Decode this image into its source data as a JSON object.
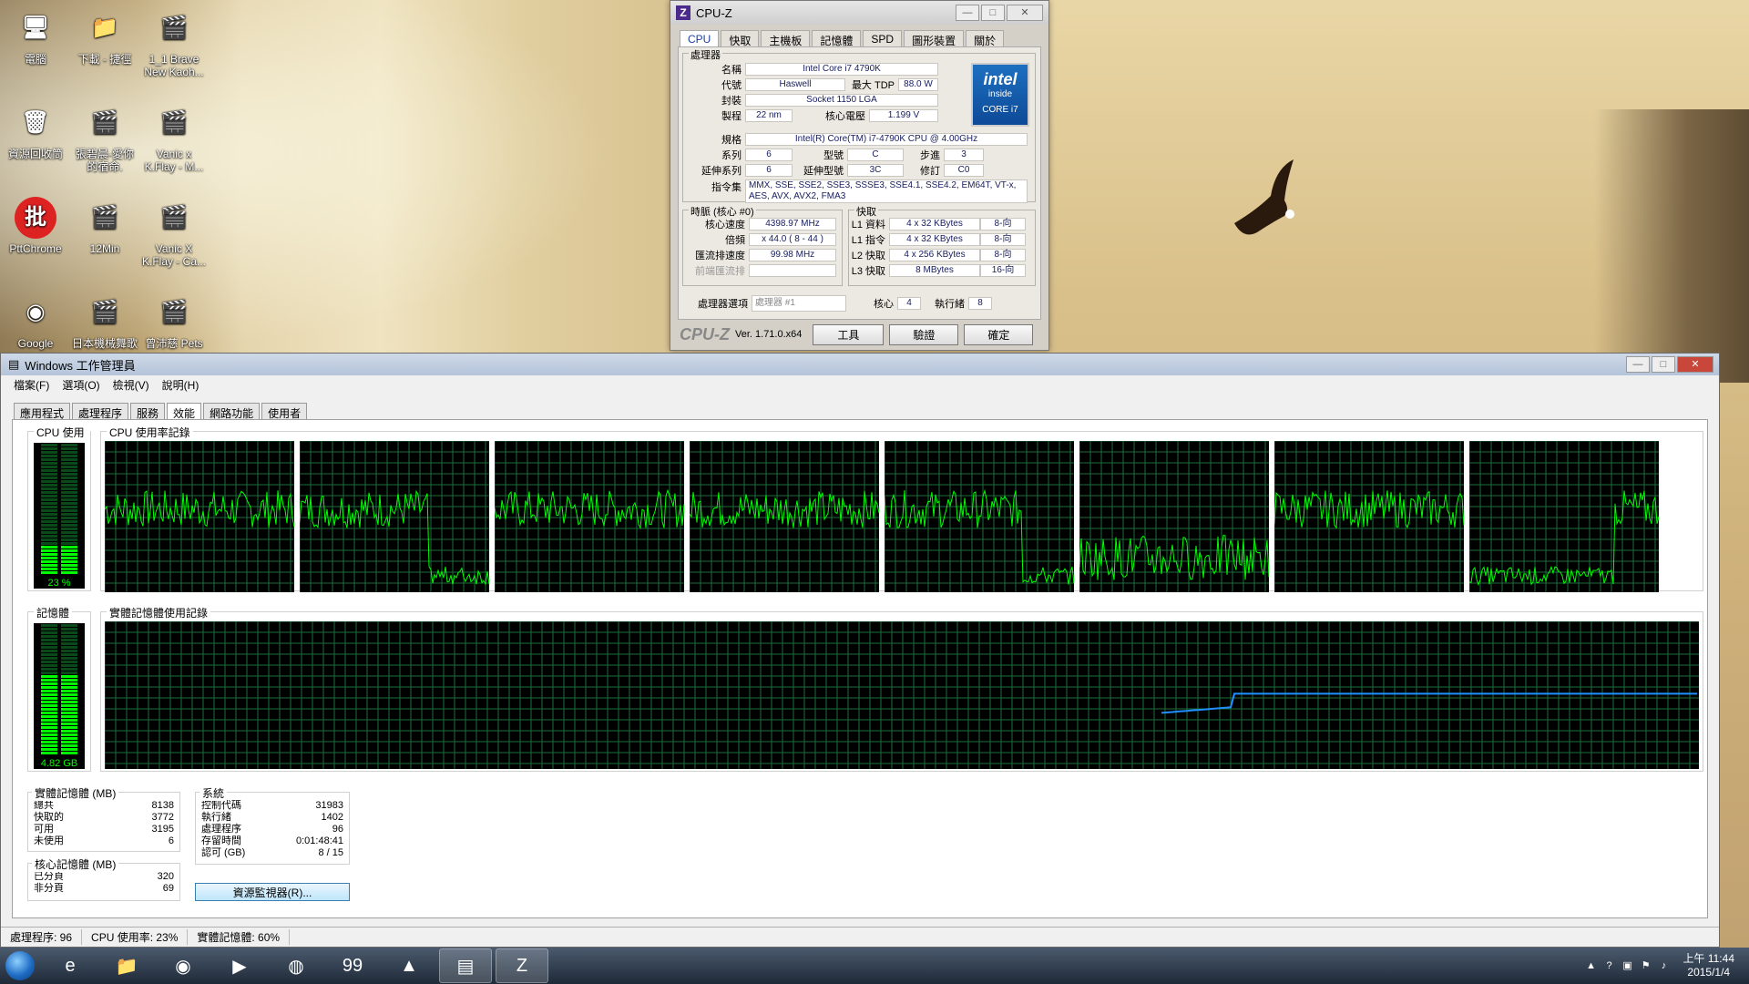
{
  "desktop": {
    "icons": [
      {
        "label": "電腦",
        "icon": "computer-icon",
        "glyph": "🖥"
      },
      {
        "label": "下載 - 捷徑",
        "icon": "folder-icon",
        "glyph": "📁"
      },
      {
        "label": "1_1 Brave New Kaoh...",
        "icon": "video-icon",
        "glyph": "🎬"
      },
      {
        "label": "資源回收筒",
        "icon": "recycle-bin-icon",
        "glyph": "🗑"
      },
      {
        "label": "張碧晨-愛你的宿命.",
        "icon": "video-icon",
        "glyph": "🎬"
      },
      {
        "label": "Vanic x K.Flay - M...",
        "icon": "video-icon",
        "glyph": "🎬"
      },
      {
        "label": "PttChrome",
        "icon": "pttchrome-icon",
        "glyph": "批"
      },
      {
        "label": "12Min",
        "icon": "video-icon",
        "glyph": "🎬"
      },
      {
        "label": "Vanic X K.Flay - Ca...",
        "icon": "video-icon",
        "glyph": "🎬"
      },
      {
        "label": "Google",
        "icon": "chrome-icon",
        "glyph": "◉"
      },
      {
        "label": "日本機械舞歌",
        "icon": "video-icon",
        "glyph": "🎬"
      },
      {
        "label": "曾沛慈 Pets",
        "icon": "video-icon",
        "glyph": "🎬"
      }
    ]
  },
  "cpuz": {
    "title": "CPU-Z",
    "tabs": [
      "CPU",
      "快取",
      "主機板",
      "記憶體",
      "SPD",
      "圖形裝置",
      "關於"
    ],
    "processor_group": "處理器",
    "name_label": "名稱",
    "name": "Intel Core i7 4790K",
    "codename_label": "代號",
    "codename": "Haswell",
    "tdp_label": "最大 TDP",
    "tdp": "88.0 W",
    "package_label": "封裝",
    "package": "Socket 1150 LGA",
    "tech_label": "製程",
    "tech": "22 nm",
    "voltage_label": "核心電壓",
    "voltage": "1.199 V",
    "spec_label": "規格",
    "spec": "Intel(R) Core(TM) i7-4790K CPU @ 4.00GHz",
    "family_label": "系列",
    "family": "6",
    "model_label": "型號",
    "model": "C",
    "stepping_label": "步進",
    "stepping": "3",
    "extfamily_label": "延伸系列",
    "extfamily": "6",
    "extmodel_label": "延伸型號",
    "extmodel": "3C",
    "revision_label": "修訂",
    "revision": "C0",
    "instr_label": "指令集",
    "instr": "MMX, SSE, SSE2, SSE3, SSSE3, SSE4.1, SSE4.2, EM64T, VT-x, AES, AVX, AVX2, FMA3",
    "intel_logo": {
      "word": "intel",
      "inside": "inside",
      "brand": "CORE i7"
    },
    "clocks_group": "時脈 (核心 #0)",
    "core_speed_label": "核心速度",
    "core_speed": "4398.97 MHz",
    "multiplier_label": "倍頻",
    "multiplier": "x 44.0 ( 8 - 44 )",
    "bus_speed_label": "匯流排速度",
    "bus_speed": "99.98 MHz",
    "rated_fsb_label": "前端匯流排",
    "rated_fsb": "",
    "cache_group": "快取",
    "cache": [
      {
        "label": "L1 資料",
        "size": "4 x 32 KBytes",
        "way": "8-向"
      },
      {
        "label": "L1 指令",
        "size": "4 x 32 KBytes",
        "way": "8-向"
      },
      {
        "label": "L2 快取",
        "size": "4 x 256 KBytes",
        "way": "8-向"
      },
      {
        "label": "L3 快取",
        "size": "8 MBytes",
        "way": "16-向"
      }
    ],
    "selection_label": "處理器選項",
    "selection": "處理器 #1",
    "cores_label": "核心",
    "cores": "4",
    "threads_label": "執行緒",
    "threads": "8",
    "brand": "CPU-Z",
    "version": "Ver. 1.71.0.x64",
    "tools_label": "工具",
    "validate_label": "驗證",
    "ok_label": "確定"
  },
  "taskmgr": {
    "title": "Windows 工作管理員",
    "menu": [
      "檔案(F)",
      "選項(O)",
      "檢視(V)",
      "說明(H)"
    ],
    "tabs": [
      "應用程式",
      "處理程序",
      "服務",
      "效能",
      "網路功能",
      "使用者"
    ],
    "active_tab": 3,
    "cpu_usage_title": "CPU 使用率",
    "cpu_usage": "23 %",
    "cpu_fraction": 0.23,
    "cpu_history_title": "CPU 使用率記錄",
    "mem_title": "記憶體",
    "mem_usage": "4.82 GB",
    "mem_fraction": 0.6,
    "mem_history_title": "實體記憶體使用記錄",
    "physical": {
      "title": "實體記憶體 (MB)",
      "rows": [
        [
          "總共",
          "8138"
        ],
        [
          "快取的",
          "3772"
        ],
        [
          "可用",
          "3195"
        ],
        [
          "未使用",
          "6"
        ]
      ]
    },
    "kernel": {
      "title": "核心記憶體 (MB)",
      "rows": [
        [
          "已分頁",
          "320"
        ],
        [
          "非分頁",
          "69"
        ]
      ]
    },
    "system": {
      "title": "系統",
      "rows": [
        [
          "控制代碼",
          "31983"
        ],
        [
          "執行緒",
          "1402"
        ],
        [
          "處理程序",
          "96"
        ],
        [
          "存留時間",
          "0:01:48:41"
        ],
        [
          "認可 (GB)",
          "8 / 15"
        ]
      ]
    },
    "resmon_label": "資源監視器(R)...",
    "status": {
      "processes": "處理程序: 96",
      "cpu": "CPU 使用率: 23%",
      "mem": "實體記憶體: 60%"
    },
    "colors": {
      "grid": "#1e6e3c",
      "cpu_line": "#00ff00",
      "mem_line": "#1e90ff",
      "meter": "#00ff00"
    }
  },
  "taskbar": {
    "apps": [
      {
        "name": "ie-icon",
        "glyph": "e"
      },
      {
        "name": "explorer-icon",
        "glyph": "📁"
      },
      {
        "name": "chrome-icon",
        "glyph": "◉"
      },
      {
        "name": "visual-studio-icon",
        "glyph": "▶"
      },
      {
        "name": "media-player-icon",
        "glyph": "◍"
      },
      {
        "name": "ptt-icon",
        "glyph": "99"
      },
      {
        "name": "assassins-creed-icon",
        "glyph": "▲"
      },
      {
        "name": "task-manager-icon",
        "glyph": "▤"
      },
      {
        "name": "cpuz-icon",
        "glyph": "Z"
      }
    ],
    "clock_time": "上午 11:44",
    "clock_date": "2015/1/4"
  }
}
